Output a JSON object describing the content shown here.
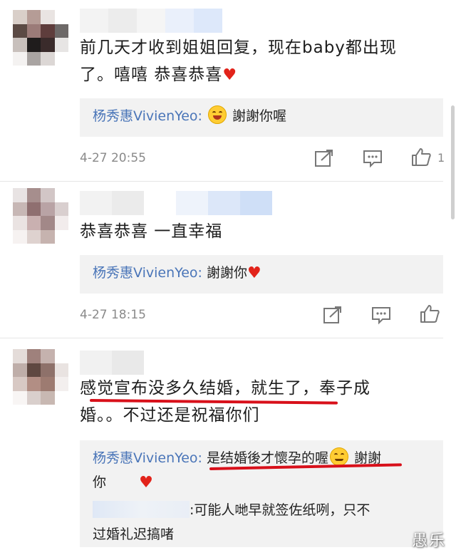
{
  "comments": [
    {
      "text": "前几天才收到姐姐回复，现在baby都出现了。嘻嘻 恭喜恭喜",
      "reply_name": "杨秀惠VivienYeo:",
      "reply_text": "謝謝你喔",
      "time": "4-27 20:55",
      "likes": "1"
    },
    {
      "text": "恭喜恭喜 一直幸福",
      "reply_name": "杨秀惠VivienYeo:",
      "reply_text": "謝謝你",
      "time": "4-27 18:15"
    },
    {
      "text_line1": "感觉宣布没多久结婚，就生了，奉子成",
      "text_line2": "婚。。不过还是祝福你们",
      "reply_name": "杨秀惠VivienYeo:",
      "reply_text_a": "是结婚後才懷孕的喔",
      "reply_text_b": "謝謝",
      "reply_text_c": "你",
      "sub_reply_line1": ":可能人哋早就签佐纸咧，只不",
      "sub_reply_line2": "过婚礼迟搞啫"
    }
  ],
  "watermark": "愚乐",
  "icons": {
    "forward": "share-icon",
    "comment": "comment-icon",
    "like": "thumbs-up-icon",
    "heart": "heart-icon",
    "emoji": "laughing-emoji-icon"
  },
  "colors": {
    "reply_name": "#4a75b8",
    "heart": "#e2231a",
    "highlight_underline": "#d8101a",
    "meta_gray": "#8a8a8a",
    "reply_bg": "#f2f2f2"
  }
}
